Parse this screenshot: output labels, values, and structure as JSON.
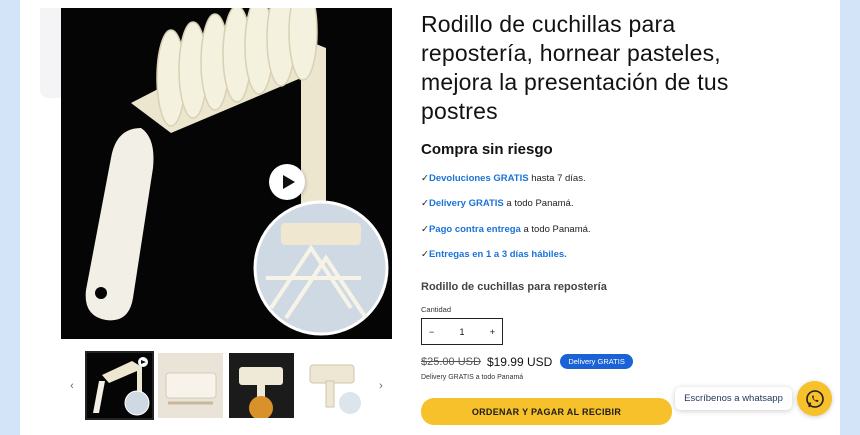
{
  "product": {
    "title": "Rodillo de cuchillas para repostería, hornear pasteles, mejora la presentación de tus postres",
    "subheading": "Compra sin riesgo",
    "features": [
      {
        "check": "✓",
        "highlight": "Devoluciones GRATIS",
        "rest": " hasta 7 días."
      },
      {
        "check": "✓",
        "highlight": "Delivery GRATIS",
        "rest": " a todo Panamá."
      },
      {
        "check": "✓",
        "highlight": "Pago contra entrega",
        "rest": " a todo Panamá."
      },
      {
        "check": "✓",
        "highlight": "Entregas en 1 a 3 días hábiles.",
        "rest": ""
      }
    ],
    "variant_name": "Rodillo de cuchillas para repostería",
    "quantity_label": "Cantidad",
    "quantity": {
      "minus": "−",
      "value": "1",
      "plus": "+"
    },
    "old_price": "$25.00 USD",
    "new_price": "$19.99 USD",
    "delivery_badge": "Delivery GRATIS",
    "delivery_note": "Delivery GRATIS a todo Panamá",
    "cta_label": "ORDENAR Y PAGAR AL RECIBIR"
  },
  "gallery": {
    "prev_arrow": "‹",
    "next_arrow": "›",
    "thumb_count": 4
  },
  "whatsapp": {
    "bubble_text": "Escríbenos a whatsapp"
  },
  "colors": {
    "accent_blue": "#1a73d8",
    "badge_blue": "#1a62d6",
    "cta_yellow": "#f6c12a",
    "background": "#d3e3f8"
  }
}
